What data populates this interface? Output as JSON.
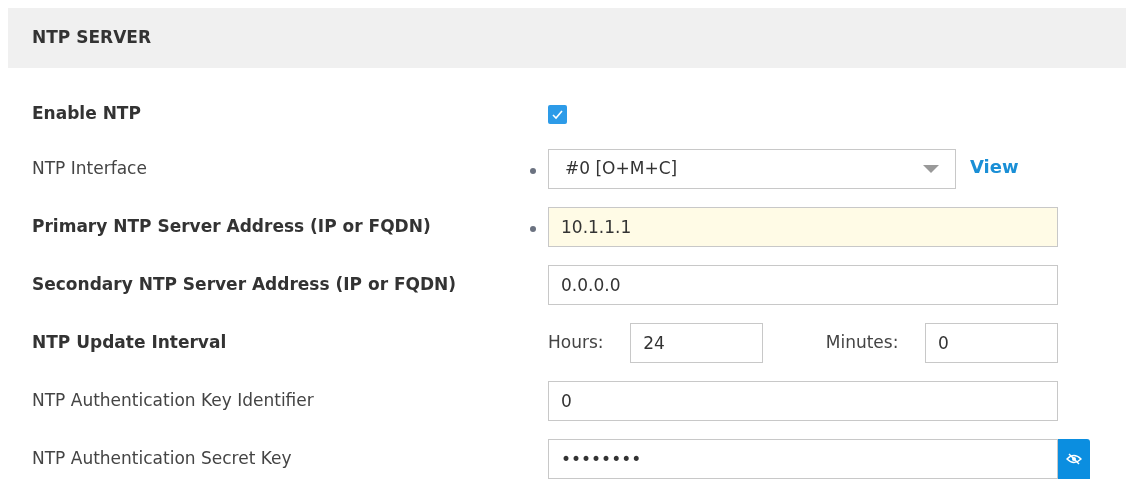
{
  "section": {
    "title": "NTP SERVER"
  },
  "rows": [
    {
      "kind": "checkbox",
      "label": "Enable NTP",
      "bold": true,
      "required": false,
      "checked": true
    },
    {
      "kind": "select",
      "label": "NTP Interface",
      "bold": false,
      "required": true,
      "value": "#0 [O+M+C]",
      "link": "View"
    },
    {
      "kind": "text",
      "label": "Primary NTP Server Address (IP or FQDN)",
      "bold": true,
      "required": true,
      "highlighted": true,
      "value": "10.1.1.1"
    },
    {
      "kind": "text",
      "label": "Secondary NTP Server Address (IP or FQDN)",
      "bold": true,
      "required": false,
      "highlighted": false,
      "value": "0.0.0.0"
    },
    {
      "kind": "interval",
      "label": "NTP Update Interval",
      "bold": true,
      "required": false,
      "hours_label": "Hours:",
      "hours": "24",
      "minutes_label": "Minutes:",
      "minutes": "0"
    },
    {
      "kind": "text",
      "label": "NTP Authentication Key Identifier",
      "bold": false,
      "required": false,
      "highlighted": false,
      "value": "0"
    },
    {
      "kind": "password",
      "label": "NTP Authentication Secret Key",
      "bold": false,
      "required": false,
      "value": "••••••••"
    }
  ]
}
